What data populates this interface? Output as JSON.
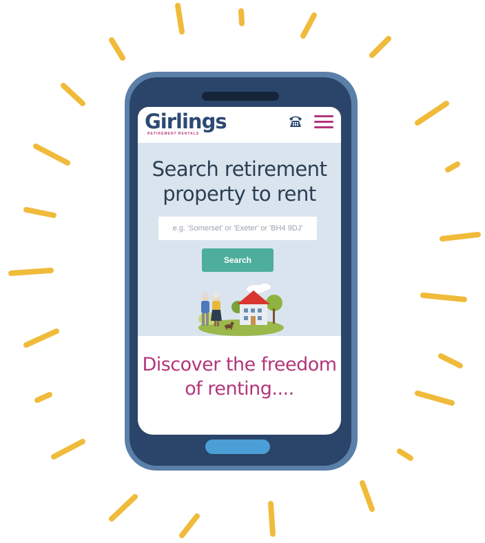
{
  "brand": {
    "name": "Girlings",
    "tagline": "RETIREMENT RENTALS"
  },
  "header": {
    "phone_icon": "telephone-icon",
    "menu_icon": "hamburger-menu-icon"
  },
  "hero": {
    "title": "Search retirement property to rent",
    "search": {
      "placeholder": "e.g. 'Somerset' or 'Exeter' or 'BH4 9DJ'",
      "value": ""
    },
    "search_button": "Search",
    "illustration": "retired-couple-with-dog-and-house"
  },
  "tagline": "Discover the freedom of renting....",
  "colors": {
    "navy": "#2c4a72",
    "magenta": "#b2357a",
    "teal": "#4cae9b",
    "hero_bg": "#d9e4ef",
    "ray_yellow": "#f0bb3b"
  }
}
